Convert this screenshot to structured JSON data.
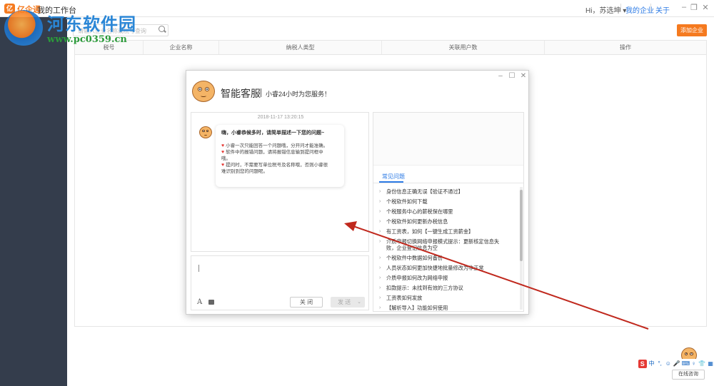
{
  "topbar": {
    "logo_badge": "亿",
    "brand": "亿企通",
    "workbench": "我的工作台",
    "greeting": "Hi，苏选坤 ▾",
    "my_company": "我的企业",
    "about": "关于"
  },
  "watermark": {
    "title": "河东软件园",
    "url": "www.pc0359.cn"
  },
  "main": {
    "search_placeholder": "请输入企业名称或税号查询",
    "add_company": "添加企业",
    "columns": [
      "税号",
      "企业名称",
      "纳税人类型",
      "关联用户数",
      "操作"
    ]
  },
  "dialog": {
    "title": "智能客服",
    "subtitle": "小睿24小时为您服务！",
    "chat": {
      "timestamp": "2018-11-17 13:20:15",
      "greeting": "嗨，小睿恭候多时，请简单描述一下您的问题~",
      "tips": [
        "小睿一次只能回答一个问题哦，分开问才能准确。",
        "软件中的报错问题，请将报错信息输到提问框中",
        "哦。",
        "提问时，不需要写单位税号及名称哦，否则小睿很",
        "难识别到您的问题呢。"
      ]
    },
    "input": {
      "close_label": "关 闭",
      "send_label": "发 送"
    },
    "faq": {
      "tab_label": "常见问题",
      "items": [
        "身份信息正确无误【验证不通过】",
        "个税软件如何下载",
        "个税服务中心的薪税保在哪里",
        "个税软件如何更新办税信息",
        "有工资表，如何【一键生成工资薪金】",
        "介质申报切换网络申报模式提示：更新核定信息失",
        "败，企业登记信息为空",
        "个税软件中数据如何备份",
        "人员状态如何更加快捷地批量修改为非正常",
        "介质申报如何改为网络申报",
        "扣款提示：未找到有效的三方协议",
        "工资表如何发放",
        "【解析导入】功能如何使用"
      ]
    }
  },
  "assistant": {
    "online_label": "在线咨询",
    "ime_logo": "S",
    "ime_glyphs": [
      "中",
      "°,",
      "☺",
      "🎤",
      "⌨",
      "♀",
      "👕",
      "▦"
    ]
  },
  "colors": {
    "accent": "#f57a1f",
    "sidebar": "#343d4c",
    "link": "#2d7be5",
    "arrow": "#c0281d"
  }
}
